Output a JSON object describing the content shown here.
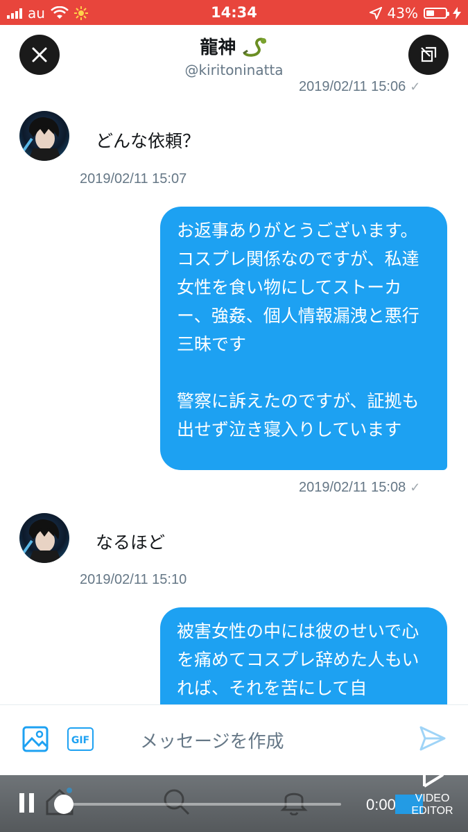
{
  "status_bar": {
    "carrier": "au",
    "time": "14:34",
    "battery_percent": "43%",
    "battery_level": 0.43,
    "background_color": "#e8453c"
  },
  "header": {
    "title": "龍神",
    "handle": "@kiritoninatta",
    "close_icon": "close-icon",
    "expand_icon": "expand-icon"
  },
  "conversation": {
    "ts_0": "2019/02/11 15:06",
    "in_1": "どんな依頼？",
    "ts_1": "2019/02/11 15:07",
    "out_1": "お返事ありがとうございます。コスプレ関係なのですが、私達女性を食い物にしてストーカー、強姦、個人情報漏洩と悪行三昧です\n\n警察に訴えたのですが、証拠も出せず泣き寝入りしています",
    "ts_2": "2019/02/11 15:08",
    "in_2": "なるほど",
    "ts_3": "2019/02/11 15:10",
    "out_2": "被害女性の中には彼のせいで心を痛めてコスプレ辞めた人もいれば、それを苦にして自",
    "bubble_color": "#1da1f2"
  },
  "compose": {
    "gif_label": "GIF",
    "placeholder": "メッセージを作成"
  },
  "video": {
    "time": "0:00",
    "watermark": "VIDEO EDITOR",
    "progress": 0.0
  }
}
